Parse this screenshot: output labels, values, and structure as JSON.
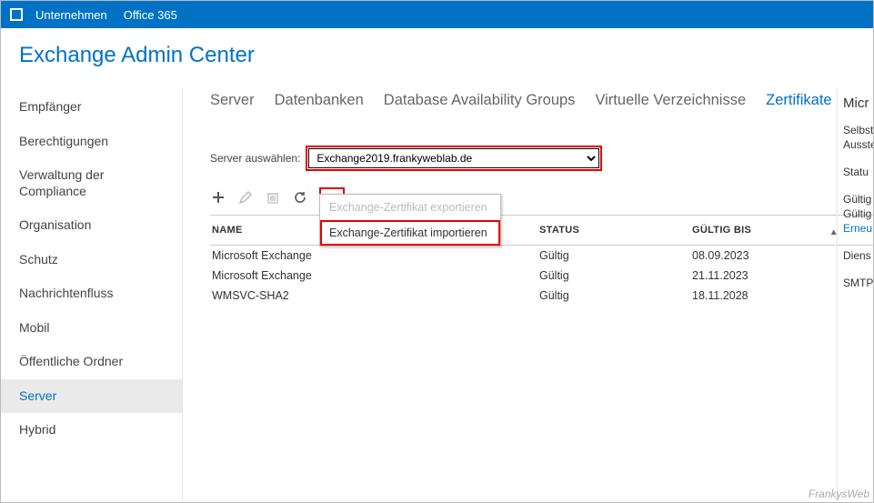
{
  "topbar": {
    "company": "Unternehmen",
    "office": "Office 365"
  },
  "page_title": "Exchange Admin Center",
  "leftnav": {
    "items": [
      {
        "label": "Empfänger"
      },
      {
        "label": "Berechtigungen"
      },
      {
        "label": "Verwaltung der Compliance"
      },
      {
        "label": "Organisation"
      },
      {
        "label": "Schutz"
      },
      {
        "label": "Nachrichtenfluss"
      },
      {
        "label": "Mobil"
      },
      {
        "label": "Öffentliche Ordner"
      },
      {
        "label": "Server",
        "selected": true
      },
      {
        "label": "Hybrid"
      }
    ]
  },
  "tabs": {
    "items": [
      {
        "label": "Server"
      },
      {
        "label": "Datenbanken"
      },
      {
        "label": "Database Availability Groups"
      },
      {
        "label": "Virtuelle Verzeichnisse"
      },
      {
        "label": "Zertifikate",
        "selected": true
      }
    ]
  },
  "server_select": {
    "label": "Server auswählen:",
    "value": "Exchange2019.frankyweblab.de"
  },
  "table": {
    "headers": {
      "name": "NAME",
      "status": "STATUS",
      "valid": "GÜLTIG BIS"
    },
    "rows": [
      {
        "name": "Microsoft Exchange",
        "status": "Gültig",
        "valid": "08.09.2023"
      },
      {
        "name": "Microsoft Exchange",
        "status": "Gültig",
        "valid": "21.11.2023"
      },
      {
        "name": "WMSVC-SHA2",
        "status": "Gültig",
        "valid": "18.11.2028"
      }
    ]
  },
  "moremenu": {
    "export": "Exchange-Zertifikat exportieren",
    "import": "Exchange-Zertifikat importieren"
  },
  "details": {
    "title": "Micr",
    "l1": "Selbst",
    "l2": "Ausste",
    "l3": "Statu",
    "l4": "Gültig",
    "l5": "Gültig",
    "link": "Erneu",
    "l6": "Diens",
    "l7": "SMTP"
  },
  "watermark": "FrankysWeb"
}
